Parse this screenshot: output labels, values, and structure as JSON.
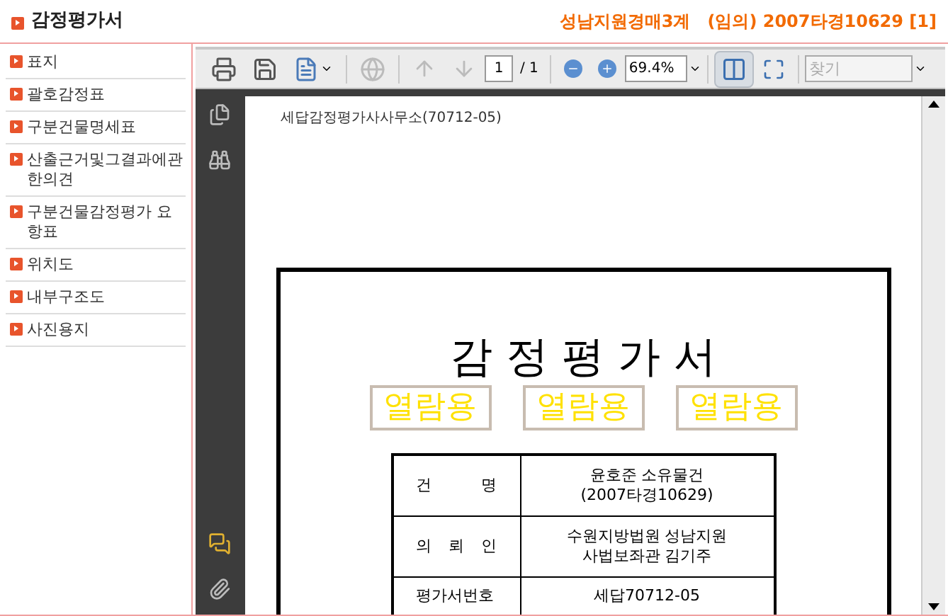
{
  "header": {
    "title": "감정평가서",
    "case_info": "성남지원경매3계　(임의) 2007타경10629 [1]"
  },
  "sidebar": {
    "items": [
      {
        "label": "표지"
      },
      {
        "label": "괄호감정표"
      },
      {
        "label": "구분건물명세표"
      },
      {
        "label": "산출근거및그결과에관한의견"
      },
      {
        "label": "구분건물감정평가 요항표"
      },
      {
        "label": "위치도"
      },
      {
        "label": "내부구조도"
      },
      {
        "label": "사진용지"
      }
    ]
  },
  "toolbar": {
    "page_value": "1",
    "page_total": "/ 1",
    "zoom_value": "69.4%",
    "search_placeholder": "찾기",
    "fit_width": {
      "selected": true
    },
    "fit_page": {
      "selected": false
    }
  },
  "document": {
    "office_line": "세답감정평가사사무소(70712-05)",
    "title": "감 정 평 가 서",
    "stamps": [
      "열람용",
      "열람용",
      "열람용"
    ],
    "table": [
      {
        "label": "건 명",
        "lines": [
          "윤호준 소유물건",
          "(2007타경10629)"
        ]
      },
      {
        "label": "의 뢰 인",
        "lines": [
          "수원지방법원 성남지원",
          "사법보좌관 김기주"
        ]
      },
      {
        "label": "평가서번호",
        "lines": [
          "세답70712-05"
        ]
      }
    ]
  }
}
